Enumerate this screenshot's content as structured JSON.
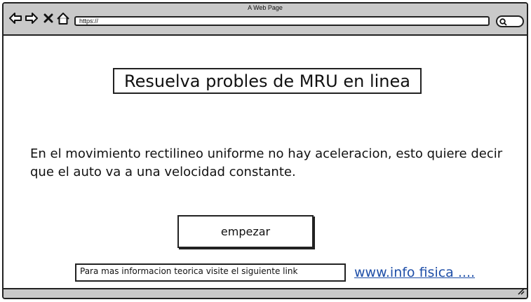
{
  "window": {
    "title": "A Web Page"
  },
  "toolbar": {
    "icons": [
      "back-arrow-icon",
      "forward-arrow-icon",
      "close-x-icon",
      "home-icon",
      "search-icon"
    ],
    "url": "https://"
  },
  "page": {
    "heading": "Resuelva probles de MRU en linea",
    "description": "En el movimiento rectilineo uniforme no hay aceleracion, esto quiere decir que el auto va a una velocidad constante.",
    "start_button": "empezar",
    "info_text": "Para mas informacion teorica visite el siguiente link",
    "info_link": "www.info fisica ...."
  },
  "colors": {
    "chrome": "#c9c9c9",
    "border": "#222222",
    "link": "#1f4fa8"
  }
}
